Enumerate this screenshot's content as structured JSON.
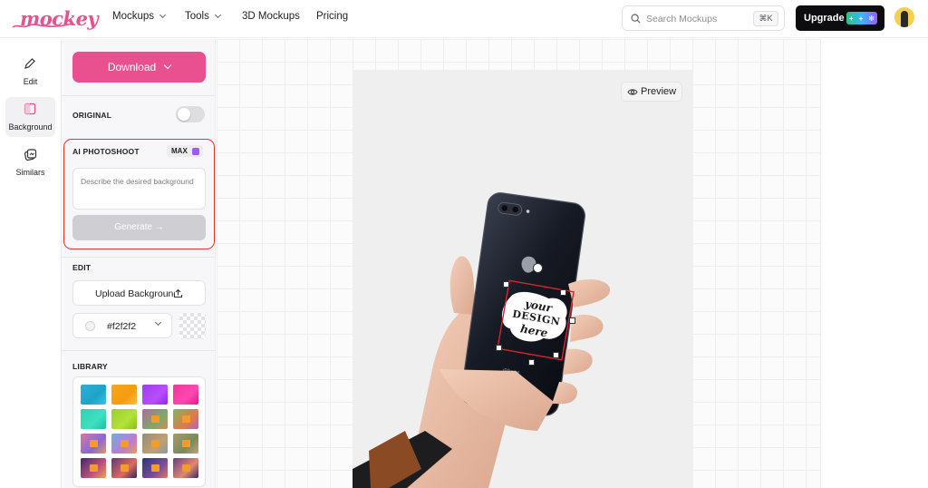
{
  "app": {
    "logo_text": "mockey"
  },
  "nav": {
    "items": [
      {
        "label": "Mockups",
        "dropdown": true
      },
      {
        "label": "Tools",
        "dropdown": true
      },
      {
        "label": "3D Mockups",
        "dropdown": false
      },
      {
        "label": "Pricing",
        "dropdown": false
      }
    ]
  },
  "search": {
    "placeholder": "Search Mockups",
    "shortcut": "⌘K"
  },
  "upgrade": {
    "label": "Upgrade"
  },
  "rail": {
    "items": [
      {
        "label": "Edit",
        "icon": "pencil-icon"
      },
      {
        "label": "Background",
        "icon": "background-icon",
        "active": true
      },
      {
        "label": "Similars",
        "icon": "similars-icon"
      }
    ]
  },
  "panel": {
    "download_label": "Download",
    "original_label": "ORIGINAL",
    "original_on": false,
    "ai": {
      "title": "AI PHOTOSHOOT",
      "badge": "MAX",
      "placeholder": "Describe the desired background",
      "generate_label": "Generate →"
    },
    "edit": {
      "title": "EDIT",
      "upload_label": "Upload Background",
      "color_value": "#f2f2f2"
    },
    "library_title": "LIBRARY"
  },
  "canvas": {
    "preview_label": "Preview",
    "sticker_lines": [
      "your",
      "DESIGN",
      "here"
    ]
  },
  "colors": {
    "brand": "#e8508f",
    "highlight_border": "#e1362c",
    "selection": "#d6262a",
    "background_fill": "#f2f2f2"
  }
}
